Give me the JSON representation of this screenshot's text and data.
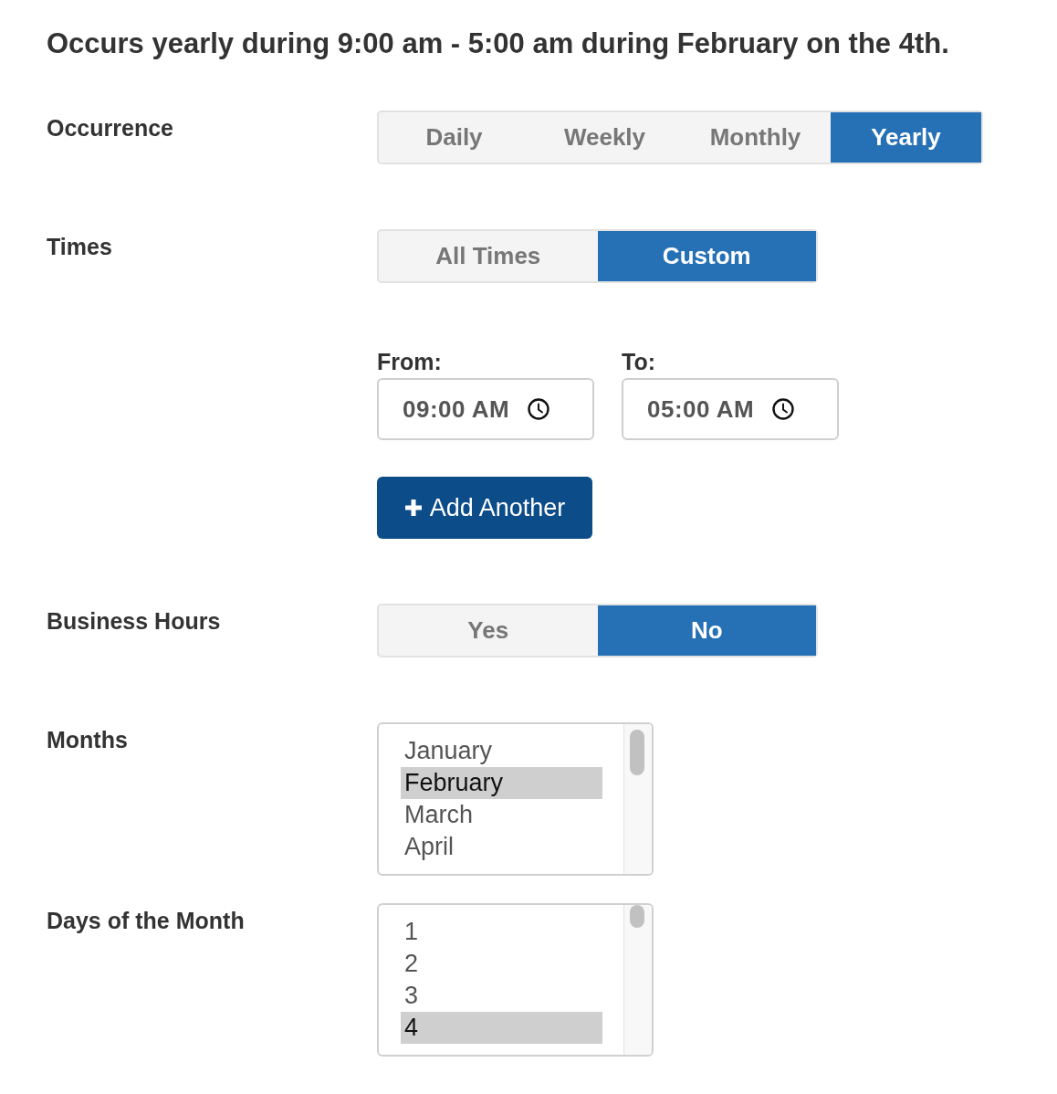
{
  "summary": "Occurs yearly during 9:00 am - 5:00 am during February on the 4th.",
  "rows": [
    {
      "kind": "segmented",
      "label": "Occurrence",
      "options": [
        {
          "label": "Daily",
          "selected": false
        },
        {
          "label": "Weekly",
          "selected": false
        },
        {
          "label": "Monthly",
          "selected": false
        },
        {
          "label": "Yearly",
          "selected": true
        }
      ]
    },
    {
      "kind": "segmented",
      "label": "Times",
      "options": [
        {
          "label": "All Times",
          "selected": false
        },
        {
          "label": "Custom",
          "selected": true
        }
      ]
    },
    {
      "kind": "time_range",
      "fields": [
        {
          "label": "From:",
          "value": "09:00 AM"
        },
        {
          "label": "To:",
          "value": "05:00 AM"
        }
      ],
      "button": "Add Another"
    },
    {
      "kind": "segmented",
      "label": "Business Hours",
      "options": [
        {
          "label": "Yes",
          "selected": false
        },
        {
          "label": "No",
          "selected": true
        }
      ]
    },
    {
      "kind": "listbox",
      "label": "Months",
      "options": [
        {
          "label": "January",
          "selected": false
        },
        {
          "label": "February",
          "selected": true
        },
        {
          "label": "March",
          "selected": false
        },
        {
          "label": "April",
          "selected": false
        }
      ]
    },
    {
      "kind": "listbox",
      "label": "Days of the Month",
      "options": [
        {
          "label": "1",
          "selected": false
        },
        {
          "label": "2",
          "selected": false
        },
        {
          "label": "3",
          "selected": false
        },
        {
          "label": "4",
          "selected": true
        }
      ]
    }
  ]
}
